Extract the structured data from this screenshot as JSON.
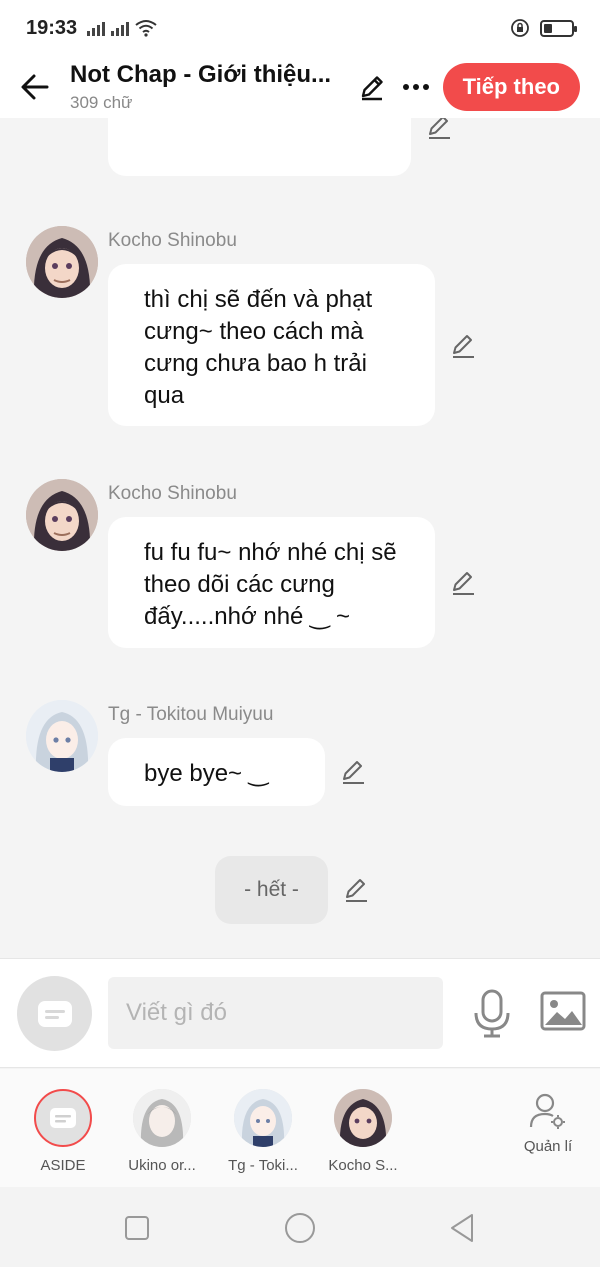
{
  "status": {
    "time": "19:33"
  },
  "header": {
    "title": "Not Chap - Giới thiệu...",
    "word_count": "309 chữ",
    "next_label": "Tiếp theo"
  },
  "messages": [
    {
      "sender": "Kocho Shinobu",
      "text": "thì chị sẽ đến và phạt cưng~ theo cách mà cưng chưa bao h trải qua"
    },
    {
      "sender": "Kocho Shinobu",
      "text": "fu fu fu~ nhớ nhé chị sẽ theo dõi các cưng đấy.....nhớ nhé ‿ ~"
    },
    {
      "sender": "Tg - Tokitou Muiyuu",
      "text": "bye bye~  ‿"
    }
  ],
  "end_text": "- hết -",
  "input": {
    "placeholder": "Viết gì đó"
  },
  "characters": [
    {
      "label": "ASIDE"
    },
    {
      "label": "Ukino or..."
    },
    {
      "label": "Tg - Toki..."
    },
    {
      "label": "Kocho S..."
    }
  ],
  "manage_label": "Quản lí",
  "colors": {
    "accent": "#f24b4b",
    "background": "#f4f4f4"
  }
}
